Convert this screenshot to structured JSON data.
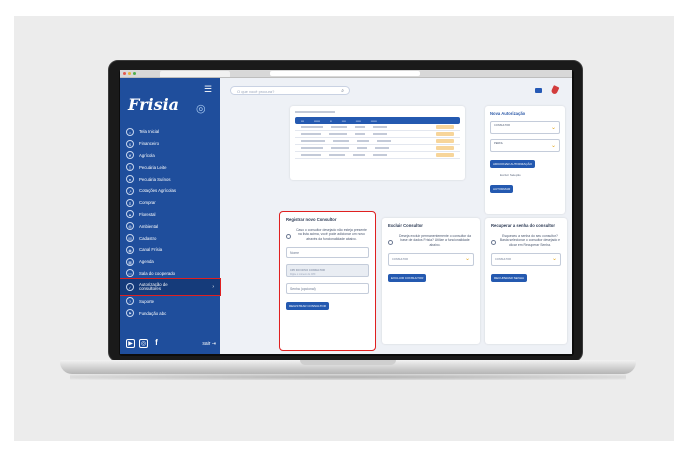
{
  "app": {
    "brand": "Frisia",
    "search_placeholder": "O que você procura?"
  },
  "sidebar": {
    "items": [
      {
        "label": "Tela Inicial",
        "icon": "home-icon"
      },
      {
        "label": "Financeiro",
        "icon": "dollar-icon"
      },
      {
        "label": "Agrícola",
        "icon": "leaf-icon"
      },
      {
        "label": "Pecuária Leite",
        "icon": "milk-icon"
      },
      {
        "label": "Pecuária Suínos",
        "icon": "pig-icon"
      },
      {
        "label": "Cotações Agrícolas",
        "icon": "chart-icon"
      },
      {
        "label": "Comprar",
        "icon": "cart-icon"
      },
      {
        "label": "Florestal",
        "icon": "tree-icon"
      },
      {
        "label": "Ambiental",
        "icon": "globe-icon"
      },
      {
        "label": "Cadastro",
        "icon": "id-card-icon"
      },
      {
        "label": "Canal Frísia",
        "icon": "broadcast-icon"
      },
      {
        "label": "Agenda",
        "icon": "calendar-icon"
      },
      {
        "label": "Sala do cooperado",
        "icon": "door-icon"
      },
      {
        "label": "Autorização de consultores",
        "icon": "user-check-icon",
        "active": true
      },
      {
        "label": "Suporte",
        "icon": "support-icon"
      },
      {
        "label": "Fundação abc",
        "icon": "flag-icon"
      }
    ],
    "logout_label": "sair"
  },
  "auth_panel": {
    "title": "Nova Autorização",
    "select1_label": "CONSULTOR",
    "select2_label": "PERFIL",
    "button1": "ADICIONAR AUTORIZAÇÃO",
    "button2": "Excluir Seleção",
    "button3": "AUTORIZAR"
  },
  "register": {
    "title": "Registrar novo Consultor",
    "info": "Caso o consultor desejado não esteja presente na lista acima, você pode adicionar um novo através da funcionalidade abaixo.",
    "name_placeholder": "Nome",
    "cpf_label": "CPF DO NOVO CONSULTOR",
    "cpf_sub": "Digite o número do CPF",
    "email_placeholder": "Senha (opcional)",
    "button": "REGISTRAR CONSULTOR"
  },
  "exclude": {
    "title": "Excluir Consultor",
    "info": "Deseja excluir permanentemente o consultor da base de dados Frísia? Utilize a funcionalidade abaixo.",
    "select_label": "CONSULTOR",
    "button": "EXCLUIR CONSULTOR"
  },
  "recover": {
    "title": "Recuperar a senha do consultor",
    "info": "Esqueceu a senha do seu consultor? Basta selecionar o consultor desejado e clicar em Recuperar Senha.",
    "select_label": "CONSULTOR",
    "button": "RECUPERAR SENHA"
  },
  "colors": {
    "sidebar": "#1f4e9c",
    "accent": "#2459b0",
    "highlight": "#e02020"
  }
}
